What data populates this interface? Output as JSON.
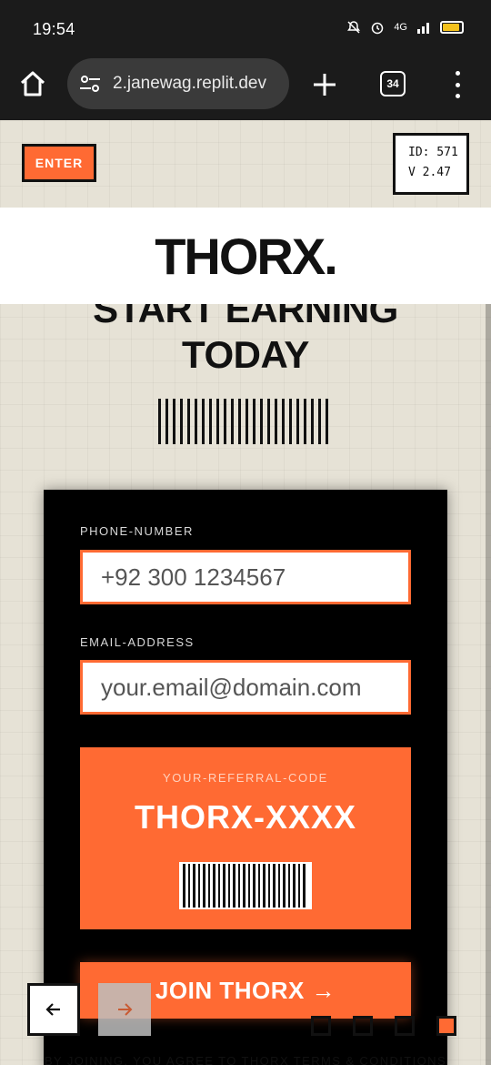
{
  "status": {
    "time": "19:54",
    "network": "4G"
  },
  "browser": {
    "url": "2.janewag.replit.dev",
    "tab_count": "34"
  },
  "header": {
    "enter_label": "ENTER",
    "id_line": "ID: 571",
    "version_line": "V 2.47",
    "logo": "THORX."
  },
  "hero": {
    "line1": "START EARNING",
    "line2": "TODAY"
  },
  "form": {
    "phone_label": "PHONE-NUMBER",
    "phone_placeholder": "+92 300 1234567",
    "email_label": "EMAIL-ADDRESS",
    "email_placeholder": "your.email@domain.com",
    "referral_label": "YOUR-REFERRAL-CODE",
    "referral_code": "THORX-XXXX",
    "join_label": "JOIN THORX →"
  },
  "carousel": {
    "prev_icon": "arrow-left-icon",
    "next_icon": "arrow-right-icon",
    "active_index": 3,
    "total": 4
  },
  "footer": {
    "terms": "BY JOINING, YOU AGREE TO THORX TERMS & CONDITIONS"
  },
  "colors": {
    "accent": "#ff6a33",
    "background": "#e6e2d6",
    "dark": "#111111"
  }
}
